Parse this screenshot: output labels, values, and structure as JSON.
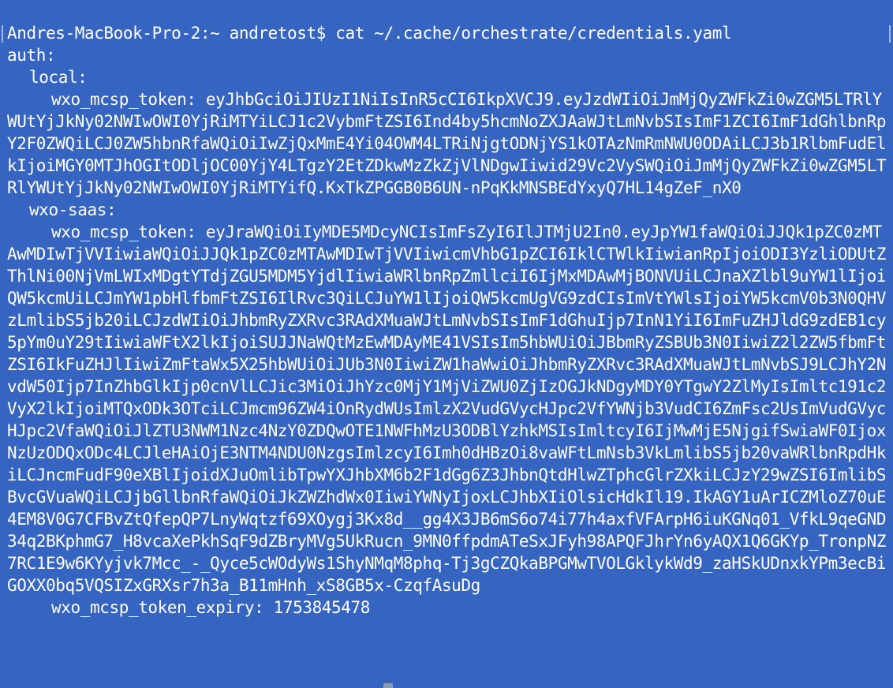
{
  "terminal": {
    "prompt_line": "Andres-MacBook-Pro-2:~ andretost$ cat ~/.cache/orchestrate/credentials.yaml",
    "auth_key": "auth:",
    "local_key": "local:",
    "local_token_line": "wxo_mcsp_token: eyJhbGciOiJIUzI1NiIsInR5cCI6IkpXVCJ9.eyJzdWIiOiJmMjQyZWFkZi0wZGM5LTRlYWUtYjJkNy02NWIwOWI0YjRiMTYiLCJ1c2VybmFtZSI6Ind4by5hcmNoZXJAaWJtLmNvbSIsImF1ZCI6ImF1dGhlbnRpY2F0ZWQiLCJ0ZW5hbnRfaWQiOiIwZjQxMmE4Yi04OWM4LTRiNjgtODNjYS1kOTAzNmRmNWU0ODAiLCJ3b1RlbmFudElkIjoiMGY0MTJhOGItODljOC00YjY4LTgzY2EtZDkwMzZkZjVlNDgwIiwid29Vc2VySWQiOiJmMjQyZWFkZi0wZGM5LTRlYWUtYjJkNy02NWIwOWI0YjRiMTYifQ.KxTkZPGGB0B6UN-nPqKkMNSBEdYxyQ7HL14gZeF_nX0",
    "saas_key": "wxo-saas:",
    "saas_token_line": "wxo_mcsp_token: eyJraWQiOiIyMDE5MDcyNCIsImFsZyI6IlJTMjU2In0.eyJpYW1faWQiOiJJQk1pZC0zMTAwMDIwTjVVIiwiaWQiOiJJQk1pZC0zMTAwMDIwTjVVIiwicmVhbG1pZCI6IklCTWlkIiwianRpIjoiODI3YzliODUtZThlNi00NjVmLWIxMDgtYTdjZGU5MDM5YjdlIiwiaWRlbnRpZmllciI6IjMxMDAwMjBONVUiLCJnaXZlbl9uYW1lIjoiQW5kcmUiLCJmYW1pbHlfbmFtZSI6IlRvc3QiLCJuYW1lIjoiQW5kcmUgVG9zdCIsImVtYWlsIjoiYW5kcmV0b3N0QHVzLmlibS5jb20iLCJzdWIiOiJhbmRyZXRvc3RAdXMuaWJtLmNvbSIsImF1dGhuIjp7InN1YiI6ImFuZHJldG9zdEB1cy5pYm0uY29tIiwiaWFtX2lkIjoiSUJJNaWQtMzEwMDAyME41VSIsIm5hbWUiOiJBbmRyZSBUb3N0IiwiZ2l2ZW5fbmFtZSI6IkFuZHJlIiwiZmFtaWx5X25hbWUiOiJUb3N0IiwiZW1haWwiOiJhbmRyZXRvc3RAdXMuaWJtLmNvbSJ9LCJhY2NvdW50Ijp7InZhbGlkIjp0cnVlLCJic3MiOiJhYzc0MjY1MjViZWU0ZjIzOGJkNDgyMDY0YTgwY2ZlMyIsImltc191c2VyX2lkIjoiMTQxODk3OTciLCJmcm96ZW4iOnRydWUsImlzX2VudGVycHJpc2VfYWNjb3VudCI6ZmFsc2UsImVudGVycHJpc2VfaWQiOiJlZTU3NWM1Nzc4NzY0ZDQwOTE1NWFhMzU3ODBlYzhkMSIsImltcyI6IjMwMjE5NjgifSwiaWF0IjoxNzUzODQxODc4LCJleHAiOjE3NTM4NDU0NzgsImlzcyI6Imh0dHBzOi8vaWFtLmNsb3VkLmlibS5jb20vaWRlbnRpdHkiLCJncmFudF90eXBlIjoidXJuOmlibTpwYXJhbXM6b2F1dGg6Z3JhbnQtdHlwZTphcGlrZXkiLCJzY29wZSI6ImlibSBvcGVuaWQiLCJjbGllbnRfaWQiOiJkZWZhdWx0IiwiYWNyIjoxLCJhbXIiOlsicHdkIl19.IkAGY1uArICZMloZ70uE4EM8V0G7CFBvZtQfepQP7LnyWqtzf69XOygj3Kx8d__gg4X3JB6mS6o74i77h4axfVFArpH6iuKGNq01_VfkL9qeGND34q2BKphmG7_H8vcaXePkhSqF9dZBryMVg5UkRucn_9MN0ffpdmATeSxJFyh98APQFJhrYn6yAQX1Q6GKYp_TronpNZ7RC1E9w6KYyjvk7Mcc_-_Qyce5cWOdyWs1ShyNMqM8phq-Tj3gCZQkaBPGMwTVOLGklykWd9_zaHSkUDnxkYPm3ecBiGOXX0bq5VQSIZxGRXsr7h3a_B11mHnh_xS8GB5x-CzqfAsuDg",
    "expiry_line": "wxo_mcsp_token_expiry: 1753845478"
  },
  "colors": {
    "background": "#3565C0",
    "text": "#ffffff"
  }
}
